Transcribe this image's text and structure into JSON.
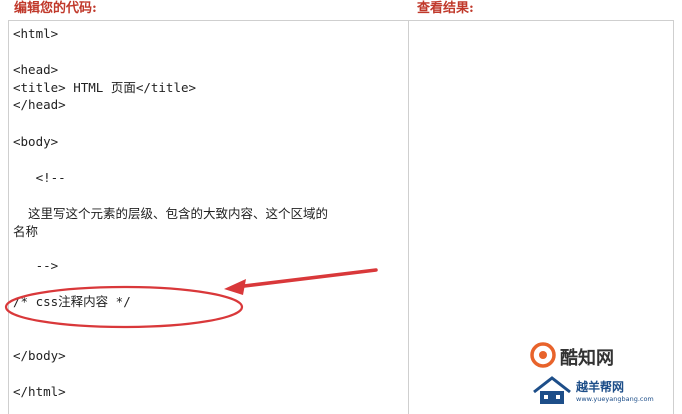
{
  "headers": {
    "editor": "编辑您的代码:",
    "result": "查看结果:"
  },
  "code_lines": [
    "<html>",
    "",
    "<head>",
    "<title> HTML 页面</title>",
    "</head>",
    "",
    "<body>",
    "",
    "   <!--",
    "",
    "  这里写这个元素的层级、包含的大致内容、这个区域的",
    "名称",
    "",
    "   -->",
    "",
    "/* css注释内容 */",
    "",
    "",
    "</body>",
    "",
    "</html>"
  ],
  "annotation_color": "#d9383a",
  "watermark": {
    "title": "酷知网",
    "subtitle": "越羊帮网",
    "url": "www.yueyangbang.com",
    "brand_color": "#e8632b",
    "blue_color": "#1d4e89"
  }
}
